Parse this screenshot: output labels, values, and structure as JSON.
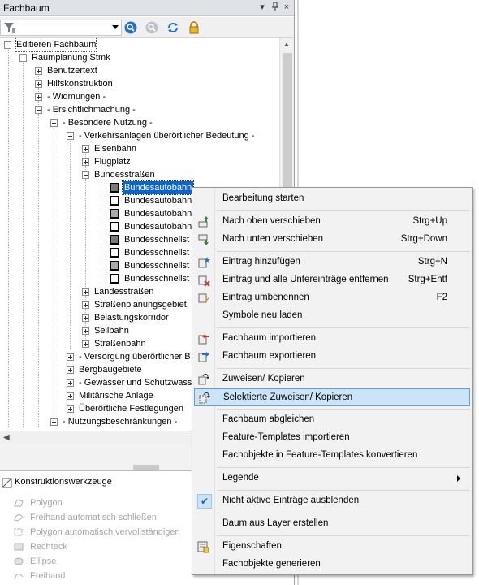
{
  "panel": {
    "title": "Fachbaum",
    "pin_glyph": "║",
    "close_glyph": "×"
  },
  "tree": {
    "items": [
      {
        "label": "Editieren Fachbaum"
      },
      {
        "label": "Raumplanung Stmk"
      },
      {
        "label": "Benutzertext"
      },
      {
        "label": "Hilfskonstruktion"
      },
      {
        "label": "- Widmungen -"
      },
      {
        "label": "- Ersichtlichmachung -"
      },
      {
        "label": "- Besondere Nutzung -"
      },
      {
        "label": "- Verkehrsanlagen überörtlicher Bedeutung -"
      },
      {
        "label": "Eisenbahn"
      },
      {
        "label": "Flugplatz"
      },
      {
        "label": "Bundesstraßen"
      },
      {
        "label": "Bundesautobahn"
      },
      {
        "label": "Bundesautobahn"
      },
      {
        "label": "Bundesautobahn"
      },
      {
        "label": "Bundesautobahn"
      },
      {
        "label": "Bundesschnellst"
      },
      {
        "label": "Bundesschnellst"
      },
      {
        "label": "Bundesschnellst"
      },
      {
        "label": "Bundesschnellst"
      },
      {
        "label": "Landesstraßen"
      },
      {
        "label": "Straßenplanungsgebiet"
      },
      {
        "label": "Belastungskorridor"
      },
      {
        "label": "Seilbahn"
      },
      {
        "label": "Straßenbahn"
      },
      {
        "label": "- Versorgung überörtlicher B"
      },
      {
        "label": "Bergbaugebiete"
      },
      {
        "label": "- Gewässer und Schutzwass"
      },
      {
        "label": "Militärische Anlage"
      },
      {
        "label": "Überörtliche Festlegungen"
      },
      {
        "label": "- Nutzungsbeschränkungen -"
      }
    ]
  },
  "konstruktion": {
    "title": "Konstruktionswerkzeuge",
    "tools": [
      {
        "label": "Polygon"
      },
      {
        "label": "Freihand automatisch schließen"
      },
      {
        "label": "Polygon automatisch vervollständigen"
      },
      {
        "label": "Rechteck"
      },
      {
        "label": "Ellipse"
      },
      {
        "label": "Freihand"
      }
    ]
  },
  "menu": {
    "items": [
      {
        "label": "Bearbeitung starten",
        "shortcut": ""
      },
      {
        "label": "Nach oben verschieben",
        "shortcut": "Strg+Up"
      },
      {
        "label": "Nach unten verschieben",
        "shortcut": "Strg+Down"
      },
      {
        "label": "Eintrag hinzufügen",
        "shortcut": "Strg+N"
      },
      {
        "label": "Eintrag und alle Untereinträge entfernen",
        "shortcut": "Strg+Entf"
      },
      {
        "label": "Eintrag umbenennen",
        "shortcut": "F2"
      },
      {
        "label": "Symbole neu laden",
        "shortcut": ""
      },
      {
        "label": "Fachbaum importieren",
        "shortcut": ""
      },
      {
        "label": "Fachbaum exportieren",
        "shortcut": ""
      },
      {
        "label": "Zuweisen/ Kopieren",
        "shortcut": ""
      },
      {
        "label": "Selektierte Zuweisen/ Kopieren",
        "shortcut": ""
      },
      {
        "label": "Fachbaum abgleichen",
        "shortcut": ""
      },
      {
        "label": "Feature-Templates importieren",
        "shortcut": ""
      },
      {
        "label": "Fachobjekte in Feature-Templates konvertieren",
        "shortcut": ""
      },
      {
        "label": "Legende",
        "shortcut": ""
      },
      {
        "label": "Nicht aktive Einträge ausblenden",
        "shortcut": ""
      },
      {
        "label": "Baum aus Layer erstellen",
        "shortcut": ""
      },
      {
        "label": "Eigenschaften",
        "shortcut": ""
      },
      {
        "label": "Fachobjekte generieren",
        "shortcut": ""
      }
    ]
  },
  "colors": {
    "selection": "#0a64d8",
    "menu_highlight": "#cce4f7"
  }
}
